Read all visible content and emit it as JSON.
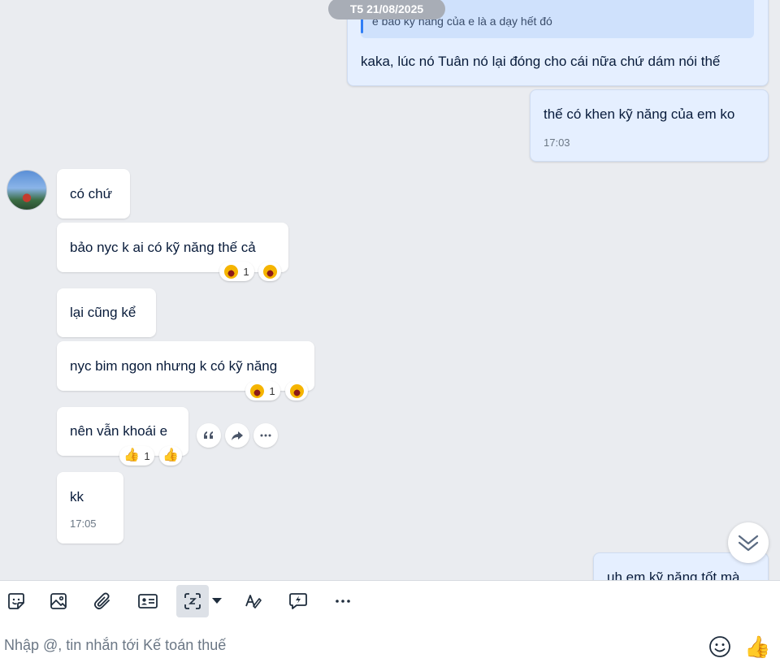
{
  "chat": {
    "date_label": "T5 21/08/2025",
    "messages_out": [
      {
        "quote_text": "e bảo kỹ năng của e là a dạy hết đó",
        "text": "kaka, lúc nó Tuân nó lại đóng cho cái nữa chứ dám nói thế"
      },
      {
        "text": "thế có khen kỹ năng của em ko",
        "time": "17:03"
      },
      {
        "text": "uh em kỹ năng tốt mà"
      }
    ],
    "messages_in": [
      {
        "text": "có chứ"
      },
      {
        "text": "bảo nyc k ai có kỹ năng thế cả",
        "reaction_count": "1"
      },
      {
        "text": "lại cũng kể"
      },
      {
        "text": "nyc bim ngon nhưng k có kỹ năng",
        "reaction_count": "1"
      },
      {
        "text": "nên vẫn khoái e",
        "reaction_count": "1"
      },
      {
        "text": "kk",
        "time": "17:05"
      }
    ]
  },
  "composer": {
    "placeholder": "Nhập @, tin nhắn tới Kế toán thuế"
  },
  "colors": {
    "accent": "#2f7df6",
    "out_bubble": "#e5efff",
    "background": "#eaecf0"
  }
}
